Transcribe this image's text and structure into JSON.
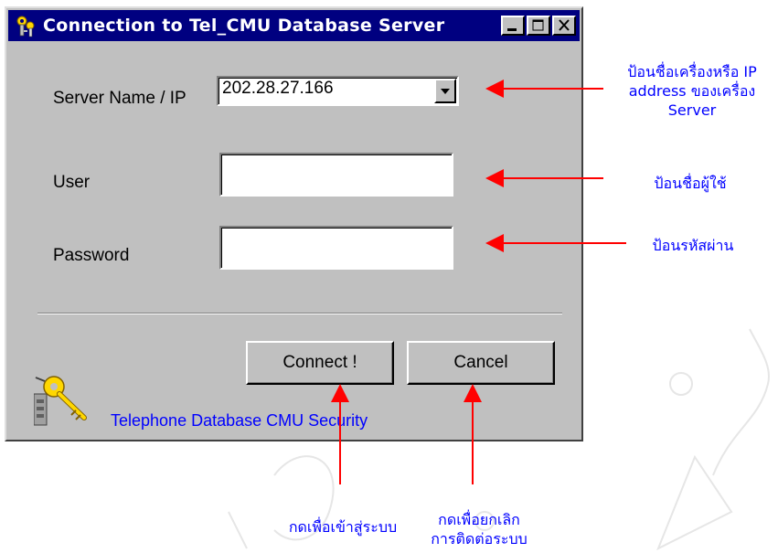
{
  "window": {
    "title": "Connection to Tel_CMU Database Server"
  },
  "form": {
    "server_label": "Server Name / IP",
    "server_value": "202.28.27.166",
    "user_label": "User",
    "user_value": "",
    "password_label": "Password",
    "password_value": ""
  },
  "buttons": {
    "connect": "Connect !",
    "cancel": "Cancel"
  },
  "footer": {
    "text": "Telephone Database CMU Security"
  },
  "annotations": {
    "server_note_line1": "ป้อนชื่อเครื่องหรือ IP",
    "server_note_line2": "address ของเครื่อง",
    "server_note_line3": "Server",
    "user_note": "ป้อนชื่อผู้ใช้",
    "password_note": "ป้อนรหัสผ่าน",
    "connect_note": "กดเพื่อเข้าสู่ระบบ",
    "cancel_note_line1": "กดเพื่อยกเลิก",
    "cancel_note_line2": "การติดต่อระบบ"
  },
  "colors": {
    "titlebar": "#000080",
    "dialog_face": "#c0c0c0",
    "annotation_text": "#0000ff",
    "arrow": "#ff0000",
    "footer_text": "#0000ff"
  },
  "icons": {
    "app": "keys-icon",
    "dropdown": "triangle-down-icon",
    "minimize": "minimize-icon",
    "maximize": "maximize-icon",
    "close": "close-icon",
    "footer": "keys-icon"
  }
}
